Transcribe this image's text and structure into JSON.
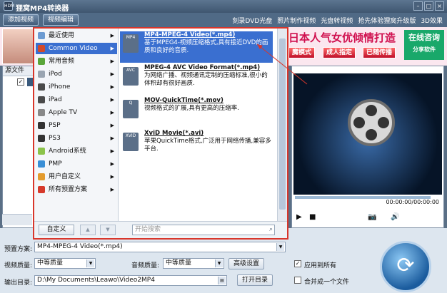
{
  "window": {
    "title": "狸窝MP4转换器",
    "logo_text": "HDM",
    "minimize": "–",
    "maximize": "□",
    "close": "×"
  },
  "toolbar": {
    "add_video": "添加视频",
    "edit_video": "视频编辑",
    "links": [
      "刻录DVD光盘",
      "照片制作视频",
      "光盘转视频",
      "抢先体验狸窝升级版",
      "3D效果"
    ]
  },
  "banner": {
    "headline": "日本人气女优倾情打造",
    "chips": [
      "魔模式",
      "成人指定",
      "已随传播",
      "分享软件"
    ],
    "consult": "在线咨询"
  },
  "source": {
    "header": "源文件",
    "checked": "✓"
  },
  "popup": {
    "categories": [
      {
        "label": "最近使用",
        "icon": "clock-icon",
        "color": "#6c9bd2",
        "sub": true
      },
      {
        "label": "Common Video",
        "icon": "film-icon",
        "color": "#d14a2b",
        "sub": true,
        "selected": true
      },
      {
        "label": "常用音频",
        "icon": "music-icon",
        "color": "#5aa63a",
        "sub": true
      },
      {
        "label": "iPod",
        "icon": "ipod-icon",
        "color": "#9aa5b1",
        "sub": true
      },
      {
        "label": "iPhone",
        "icon": "iphone-icon",
        "color": "#4a4a4a",
        "sub": true
      },
      {
        "label": "iPad",
        "icon": "ipad-icon",
        "color": "#4a4a4a",
        "sub": true
      },
      {
        "label": "Apple TV",
        "icon": "apple-icon",
        "color": "#888888",
        "sub": true
      },
      {
        "label": "PSP",
        "icon": "psp-icon",
        "color": "#333333",
        "sub": true
      },
      {
        "label": "PS3",
        "icon": "ps3-icon",
        "color": "#333333",
        "sub": true
      },
      {
        "label": "Android系统",
        "icon": "android-icon",
        "color": "#8bc34a",
        "sub": true
      },
      {
        "label": "PMP",
        "icon": "pmp-icon",
        "color": "#3a8fd6",
        "sub": true
      },
      {
        "label": "用户自定义",
        "icon": "user-icon",
        "color": "#e39b2d",
        "sub": true
      },
      {
        "label": "所有预置方案",
        "icon": "preset-icon",
        "color": "#d6392b",
        "sub": true
      }
    ],
    "formats": [
      {
        "title": "MP4-MPEG-4 Video(*.mp4)",
        "desc": "基于MPEG4-视频压缩格式,具有接近DVD的画质和良好的音质.",
        "icon": "mp4-icon",
        "badge": "MP4",
        "selected": true
      },
      {
        "title": "MPEG-4 AVC Video Format(*.mp4)",
        "desc": "为网络广播、视频通讯定制的压缩标准,很小的体积却有很好画质.",
        "icon": "avc-icon",
        "badge": "AVC"
      },
      {
        "title": "MOV-QuickTime(*.mov)",
        "desc": "视频格式的扩展,具有更高的压缩率.",
        "icon": "quicktime-icon",
        "badge": "Q"
      },
      {
        "title": "XviD Movie(*.avi)",
        "desc": "苹果QuickTime格式,广泛用于网络传播,兼容多平台.",
        "icon": "xvid-icon",
        "badge": "XVID"
      }
    ],
    "custom_button": "自定义",
    "up": "▲",
    "down": "▼",
    "search_placeholder": "开始搜索"
  },
  "preview": {
    "time": "00:00:00/00:00:00",
    "controls": [
      "▶",
      "■",
      "📷",
      "🔊"
    ]
  },
  "settings": {
    "preset_label": "预置方案:",
    "preset_value": "MP4-MPEG-4 Video(*.mp4)",
    "video_quality_label": "视频质量:",
    "video_quality_value": "中等质量",
    "audio_quality_label": "音频质量:",
    "audio_quality_value": "中等质量",
    "advanced_button": "高级设置",
    "apply_all": "应用到所有",
    "apply_all_checked": "✓",
    "output_label": "输出目录:",
    "output_path": "D:\\My Documents\\Leawo\\Video2MP4",
    "open_dir_button": "打开目录",
    "merge": "合并成一个文件"
  },
  "colors": {
    "accent": "#3a6fd0",
    "border": "#d9362b"
  }
}
